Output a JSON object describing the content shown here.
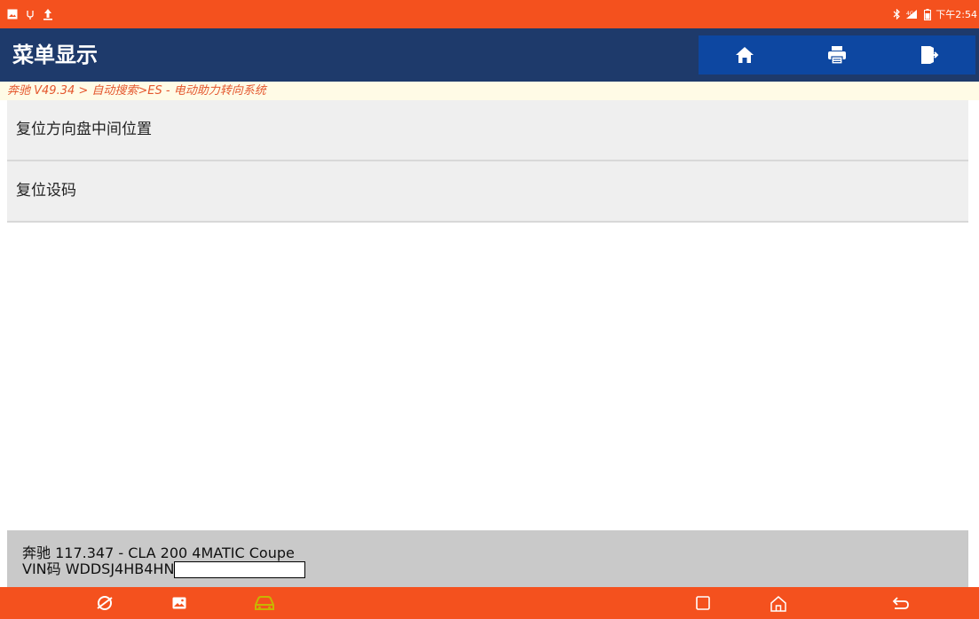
{
  "status_bar": {
    "time": "下午2:54",
    "left_icons": [
      "gallery-icon",
      "usb-icon",
      "upload-icon"
    ],
    "right_icons": [
      "bluetooth-icon",
      "signal-icon",
      "battery-icon"
    ]
  },
  "header": {
    "title": "菜单显示",
    "buttons": [
      "home-icon",
      "print-icon",
      "exit-icon"
    ]
  },
  "breadcrumb": "奔驰 V49.34 > 自动搜索>ES - 电动助力转向系统",
  "menu": {
    "items": [
      {
        "label": "复位方向盘中间位置"
      },
      {
        "label": "复位设码"
      }
    ]
  },
  "vehicle": {
    "model": "奔驰 117.347 - CLA 200 4MATIC Coupe",
    "vin_prefix": "VIN码 WDDSJ4HB4HN"
  },
  "nav_bar": {
    "left_icons": [
      "browser-icon",
      "gallery-icon",
      "car-diagnostic-icon"
    ],
    "right_icons": [
      "recent-apps-icon",
      "home-icon",
      "back-icon"
    ]
  },
  "colors": {
    "status_bar": "#f4511e",
    "title_bar": "#1e3a6b",
    "toolbar_button": "#0d47a1",
    "breadcrumb_text": "#e4572e",
    "breadcrumb_bg": "#fffbe6",
    "menu_item_bg": "#efefef",
    "vehicle_info_bg": "#c9c9c9",
    "nav_icon_active": "#c8b400"
  }
}
